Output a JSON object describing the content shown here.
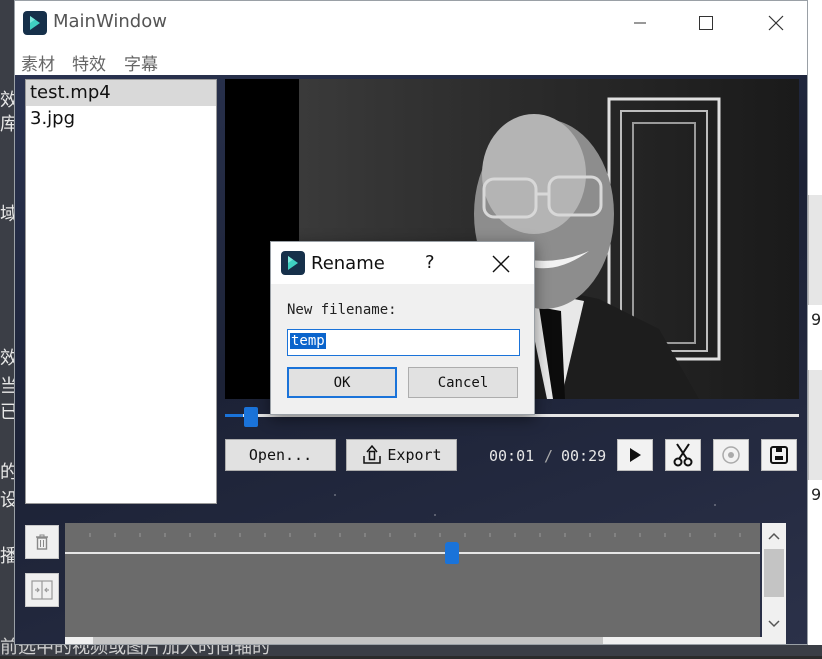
{
  "window": {
    "title": "MainWindow"
  },
  "menu": {
    "items": [
      "素材",
      "特效",
      "字幕"
    ]
  },
  "files": [
    {
      "name": "test.mp4",
      "selected": true
    },
    {
      "name": "3.jpg",
      "selected": false
    }
  ],
  "player": {
    "open_label": "Open...",
    "export_label": "Export",
    "current_time": "00:01",
    "separator": "/",
    "total_time": "00:29",
    "seek_fraction": 0.05
  },
  "timeline": {
    "playhead_fraction": 0.55
  },
  "dialog": {
    "title": "Rename",
    "help": "?",
    "label": "New filename:",
    "input_value": "temp",
    "ok_label": "OK",
    "cancel_label": "Cancel"
  },
  "background": {
    "left_glyphs": [
      "效",
      "库",
      "域",
      "效",
      "当",
      "已",
      "的",
      "设",
      "播"
    ],
    "right_numbers": [
      "9",
      "9"
    ],
    "bottom_text": "前选中的视频或图片加入时间轴的"
  },
  "colors": {
    "accent": "#1a73d9",
    "dialog_bg": "#f0f0f0",
    "timeline_bg": "#6b6b6b"
  }
}
